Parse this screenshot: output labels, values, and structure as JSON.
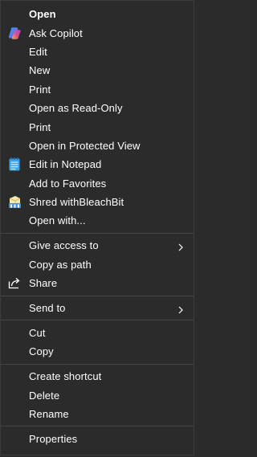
{
  "menu": {
    "open": "Open",
    "ask_copilot": "Ask Copilot",
    "edit": "Edit",
    "new": "New",
    "print": "Print",
    "open_read_only": "Open as Read-Only",
    "print_2": "Print",
    "open_protected": "Open in Protected View",
    "edit_notepad": "Edit in Notepad",
    "add_favorites": "Add to Favorites",
    "shred": "Shred withBleachBit",
    "open_with": "Open with...",
    "give_access": "Give access to",
    "copy_path": "Copy as path",
    "share": "Share",
    "send_to": "Send to",
    "cut": "Cut",
    "copy": "Copy",
    "create_shortcut": "Create shortcut",
    "delete": "Delete",
    "rename": "Rename",
    "properties": "Properties"
  },
  "icons": {
    "copilot": "copilot-icon",
    "notepad": "notepad-icon",
    "bleachbit": "bleachbit-icon",
    "share": "share-icon",
    "submenu": "chevron-right-icon"
  }
}
